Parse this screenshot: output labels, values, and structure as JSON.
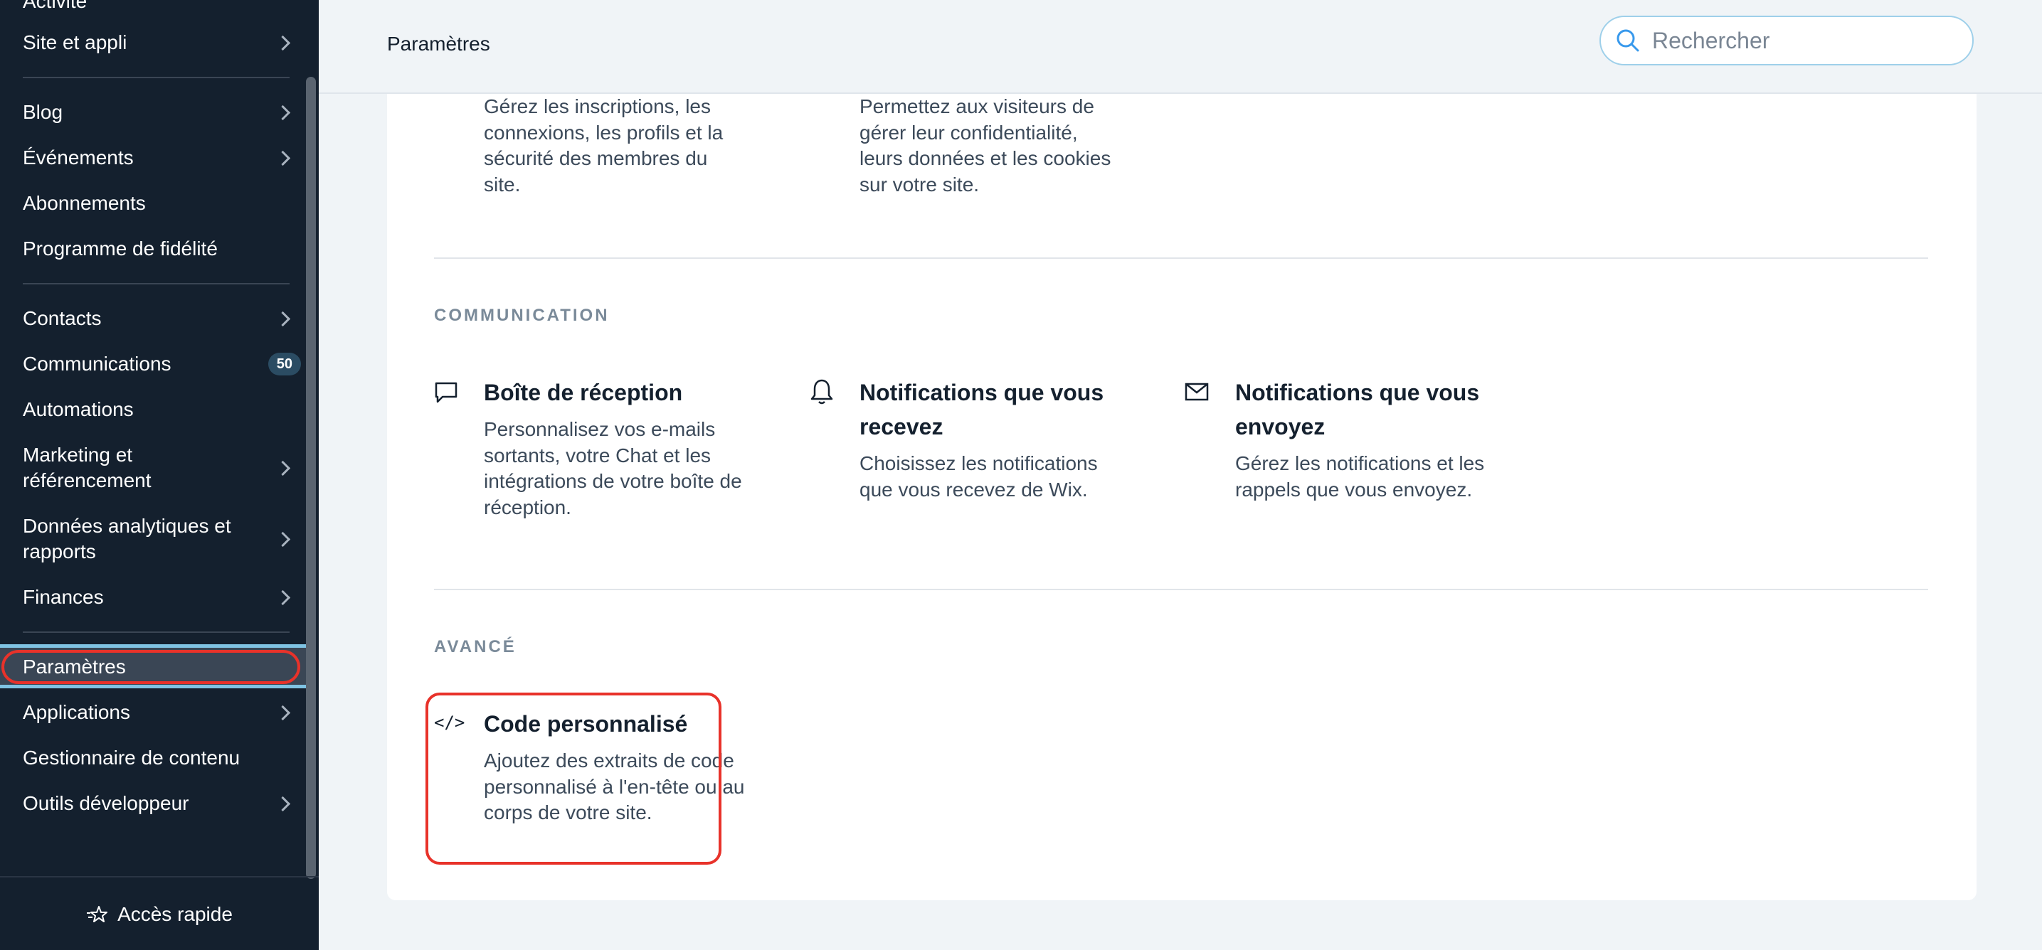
{
  "sidebar": {
    "items": [
      {
        "label": "Activité"
      },
      {
        "label": "Site et appli"
      },
      {
        "label": "Blog"
      },
      {
        "label": "Événements"
      },
      {
        "label": "Abonnements"
      },
      {
        "label": "Programme de fidélité"
      },
      {
        "label": "Contacts"
      },
      {
        "label": "Communications",
        "badge": "50"
      },
      {
        "label": "Automations"
      },
      {
        "label": "Marketing et référencement"
      },
      {
        "label": "Données analytiques et rapports"
      },
      {
        "label": "Finances"
      },
      {
        "label": "Paramètres"
      },
      {
        "label": "Applications"
      },
      {
        "label": "Gestionnaire de contenu"
      },
      {
        "label": "Outils développeur"
      }
    ],
    "quick_access": "Accès rapide"
  },
  "header": {
    "title": "Paramètres",
    "search_placeholder": "Rechercher"
  },
  "top_partial": {
    "members_desc": "Gérez les inscriptions, les connexions, les profils et la sécurité des membres du site.",
    "privacy_desc": "Permettez aux visiteurs de gérer leur confidentialité, leurs données et les cookies sur votre site."
  },
  "sections": {
    "communication": {
      "heading": "COMMUNICATION",
      "cards": [
        {
          "title": "Boîte de réception",
          "desc": "Personnalisez vos e-mails sortants, votre Chat et les intégrations de votre boîte de réception.",
          "icon": "chat-bubble-icon"
        },
        {
          "title": "Notifications que vous recevez",
          "desc": "Choisissez les notifications que vous recevez de Wix.",
          "icon": "bell-icon"
        },
        {
          "title": "Notifications que vous envoyez",
          "desc": "Gérez les notifications et les rappels que vous envoyez.",
          "icon": "envelope-icon"
        }
      ]
    },
    "advanced": {
      "heading": "AVANCÉ",
      "cards": [
        {
          "title": "Code personnalisé",
          "desc": "Ajoutez des extraits de code personnalisé à l'en-tête ou au corps de votre site.",
          "icon_text": "</>"
        }
      ]
    }
  },
  "colors": {
    "sidebar_bg": "#14202e",
    "highlight": "#e8322a",
    "active_border": "#7fc3e3"
  }
}
